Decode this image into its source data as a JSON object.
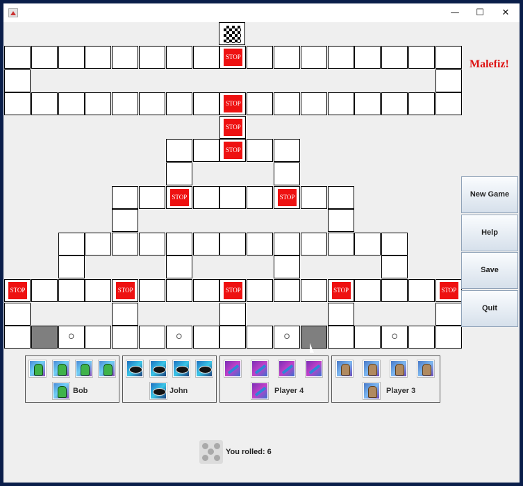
{
  "window": {
    "minimize_icon": "—",
    "maximize_icon": "☐",
    "close_icon": "✕"
  },
  "board": {
    "stop_label": "STOP",
    "start_marker": "O"
  },
  "title": "Malefiz!",
  "menu": {
    "new_game": "New Game",
    "help": "Help",
    "save": "Save",
    "quit": "Quit"
  },
  "players": [
    {
      "name": "Bob",
      "piece": "frog-figure"
    },
    {
      "name": "John",
      "piece": "black-fish"
    },
    {
      "name": "Player 4",
      "piece": "blue-stick"
    },
    {
      "name": "Player 3",
      "piece": "brown-figure"
    }
  ],
  "status": {
    "rolled_text": "You rolled: 6"
  },
  "colors": {
    "stop": "#ee1111",
    "title": "#dd1111",
    "dark_cell": "#7f7f7f"
  }
}
